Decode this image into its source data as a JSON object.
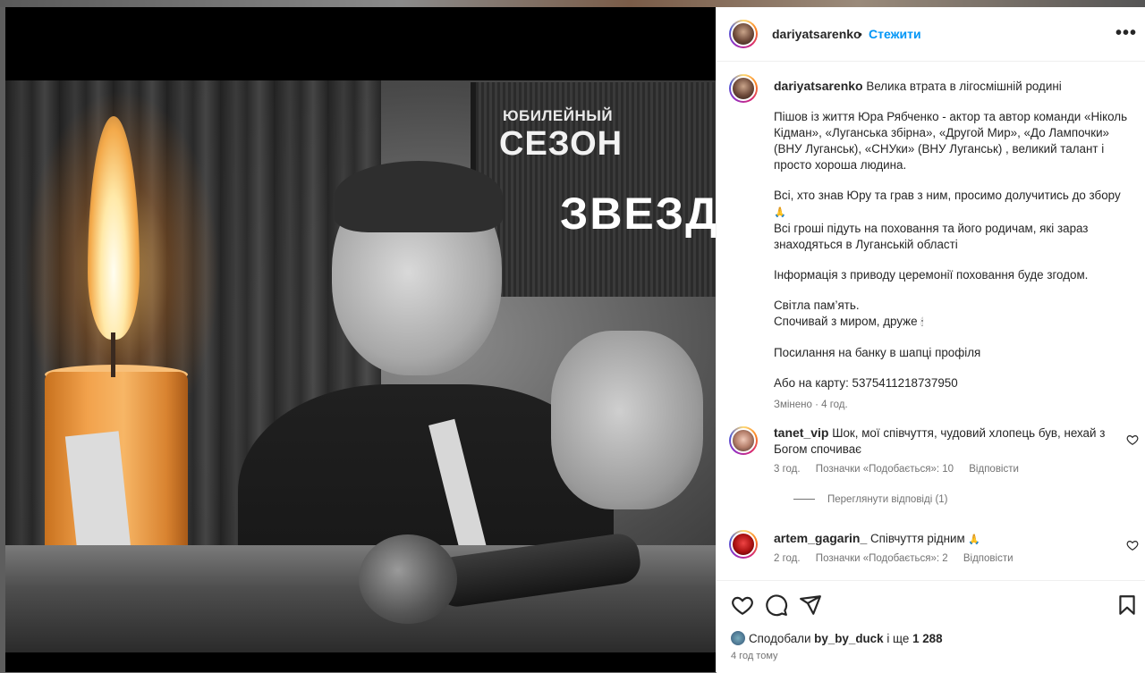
{
  "post": {
    "author": "dariyatsarenko",
    "separator": "•",
    "follow_label": "Стежити",
    "more_label": "•••"
  },
  "media": {
    "banner_line1": "ЮБИЛЕЙНЫЙ",
    "banner_line2": "СЕЗОН",
    "banner_line3": "ЗВЕЗД"
  },
  "caption": {
    "author": "dariyatsarenko",
    "first_line": "Велика втрата в лігосмішній родині",
    "p1": "Пішов із життя Юра Рябченко - актор та автор команди «Ніколь Кідман», «Луганська збірна», «Другой Мир», «До Лампочки» (ВНУ Луганськ), «СНУки» (ВНУ Луганськ) , великий талант і просто хороша людина.",
    "p2a": "Всі, хто знав Юру та грав з ним, просимо долучитись до збору",
    "p2b": "Всі гроші підуть на поховання та його родичам, які зараз знаходяться в Луганській області",
    "p3": "Інформація з приводу церемонії поховання буде згодом.",
    "p4a": "Світла пам’ять.",
    "p4b": "Спочивай з миром, друже",
    "p5": "Посилання на банку в шапці профіля",
    "p6": "Або на карту: 5375411218737950",
    "edited": "Змінено · 4 год."
  },
  "comments": [
    {
      "author": "tanet_vip",
      "text": "Шок, мої співчуття, чудовий хлопець був, нехай з Богом спочиває",
      "time": "3 год.",
      "likes": "Позначки «Подобається»: 10",
      "reply": "Відповісти",
      "view_replies": "Переглянути відповіді (1)"
    },
    {
      "author": "artem_gagarin_",
      "text": "Співчуття рідним",
      "time": "2 год.",
      "likes": "Позначки «Подобається»: 2",
      "reply": "Відповісти"
    }
  ],
  "footer": {
    "liked_prefix": "Сподобали",
    "liked_user": "by_by_duck",
    "liked_middle": "і ще",
    "liked_count": "1 288",
    "time_ago": "4 год тому"
  },
  "icons": {
    "like": "heart-icon",
    "comment": "comment-icon",
    "share": "share-icon",
    "save": "bookmark-icon"
  }
}
